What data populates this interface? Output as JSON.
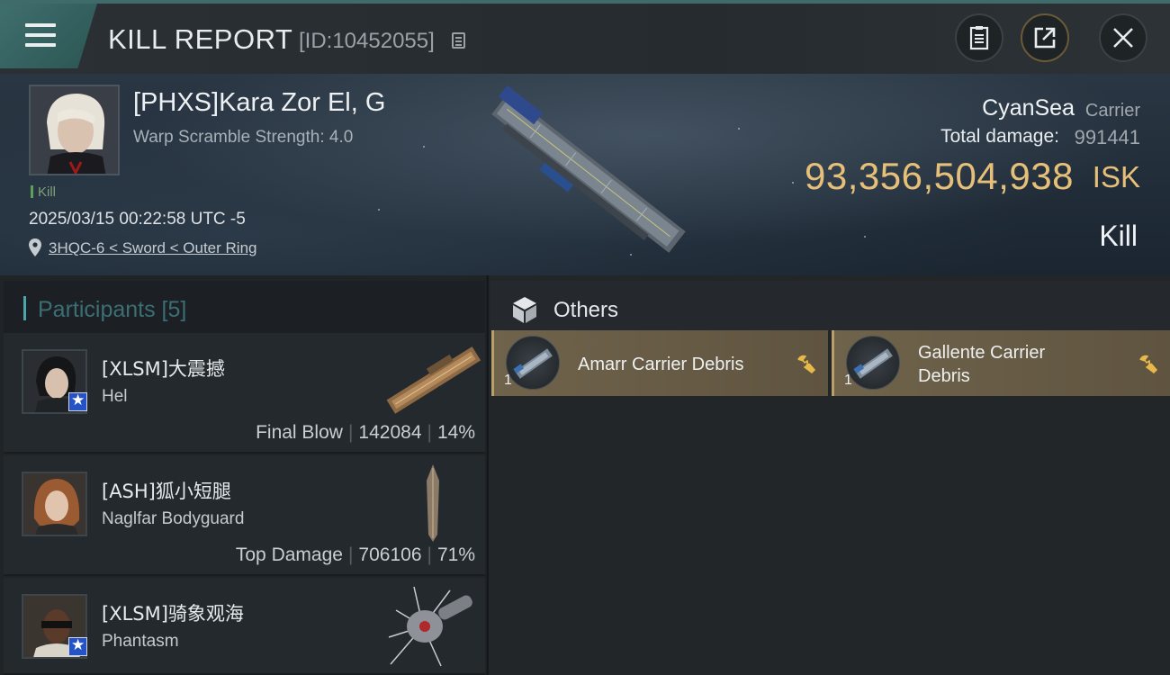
{
  "header": {
    "title": "KILL REPORT",
    "report_id": "[ID:10452055]"
  },
  "victim": {
    "name": "[PHXS]Kara Zor El, G",
    "warp_scramble": "Warp Scramble Strength: 4.0",
    "kill_tag": "Kill",
    "timestamp": "2025/03/15 00:22:58 UTC -5",
    "location": "3HQC-6 < Sword < Outer Ring",
    "corp": "CyanSea",
    "ship_class": "Carrier",
    "total_damage_label": "Total damage:",
    "total_damage_value": "991441",
    "isk_value": "93,356,504,938",
    "isk_unit": "ISK",
    "kill_type": "Kill"
  },
  "participants": {
    "header": "Participants [5]",
    "items": [
      {
        "name": "[XLSM]大震撼",
        "ship": "Hel",
        "role": "Final Blow",
        "damage": "142084",
        "percent": "14%",
        "badge": true
      },
      {
        "name": "[ASH]狐小短腿",
        "ship": "Naglfar Bodyguard",
        "role": "Top Damage",
        "damage": "706106",
        "percent": "71%",
        "badge": false
      },
      {
        "name": "[XLSM]骑象观海",
        "ship": "Phantasm",
        "role": "",
        "damage": "",
        "percent": "",
        "badge": true
      }
    ]
  },
  "others": {
    "header": "Others",
    "items": [
      {
        "name": "Amarr Carrier Debris",
        "qty": "1"
      },
      {
        "name_line1": "Gallente Carrier",
        "name_line2": "Debris",
        "qty": "1"
      }
    ]
  },
  "colors": {
    "accent_teal": "#3f6f6d",
    "isk_gold": "#e6c078",
    "debris_card": "#6f634b"
  },
  "icons": [
    "menu-icon",
    "copy-icon",
    "clipboard-icon",
    "share-icon",
    "close-icon",
    "location-pin-icon",
    "cube-icon",
    "wrench-icon",
    "star-badge-icon"
  ]
}
